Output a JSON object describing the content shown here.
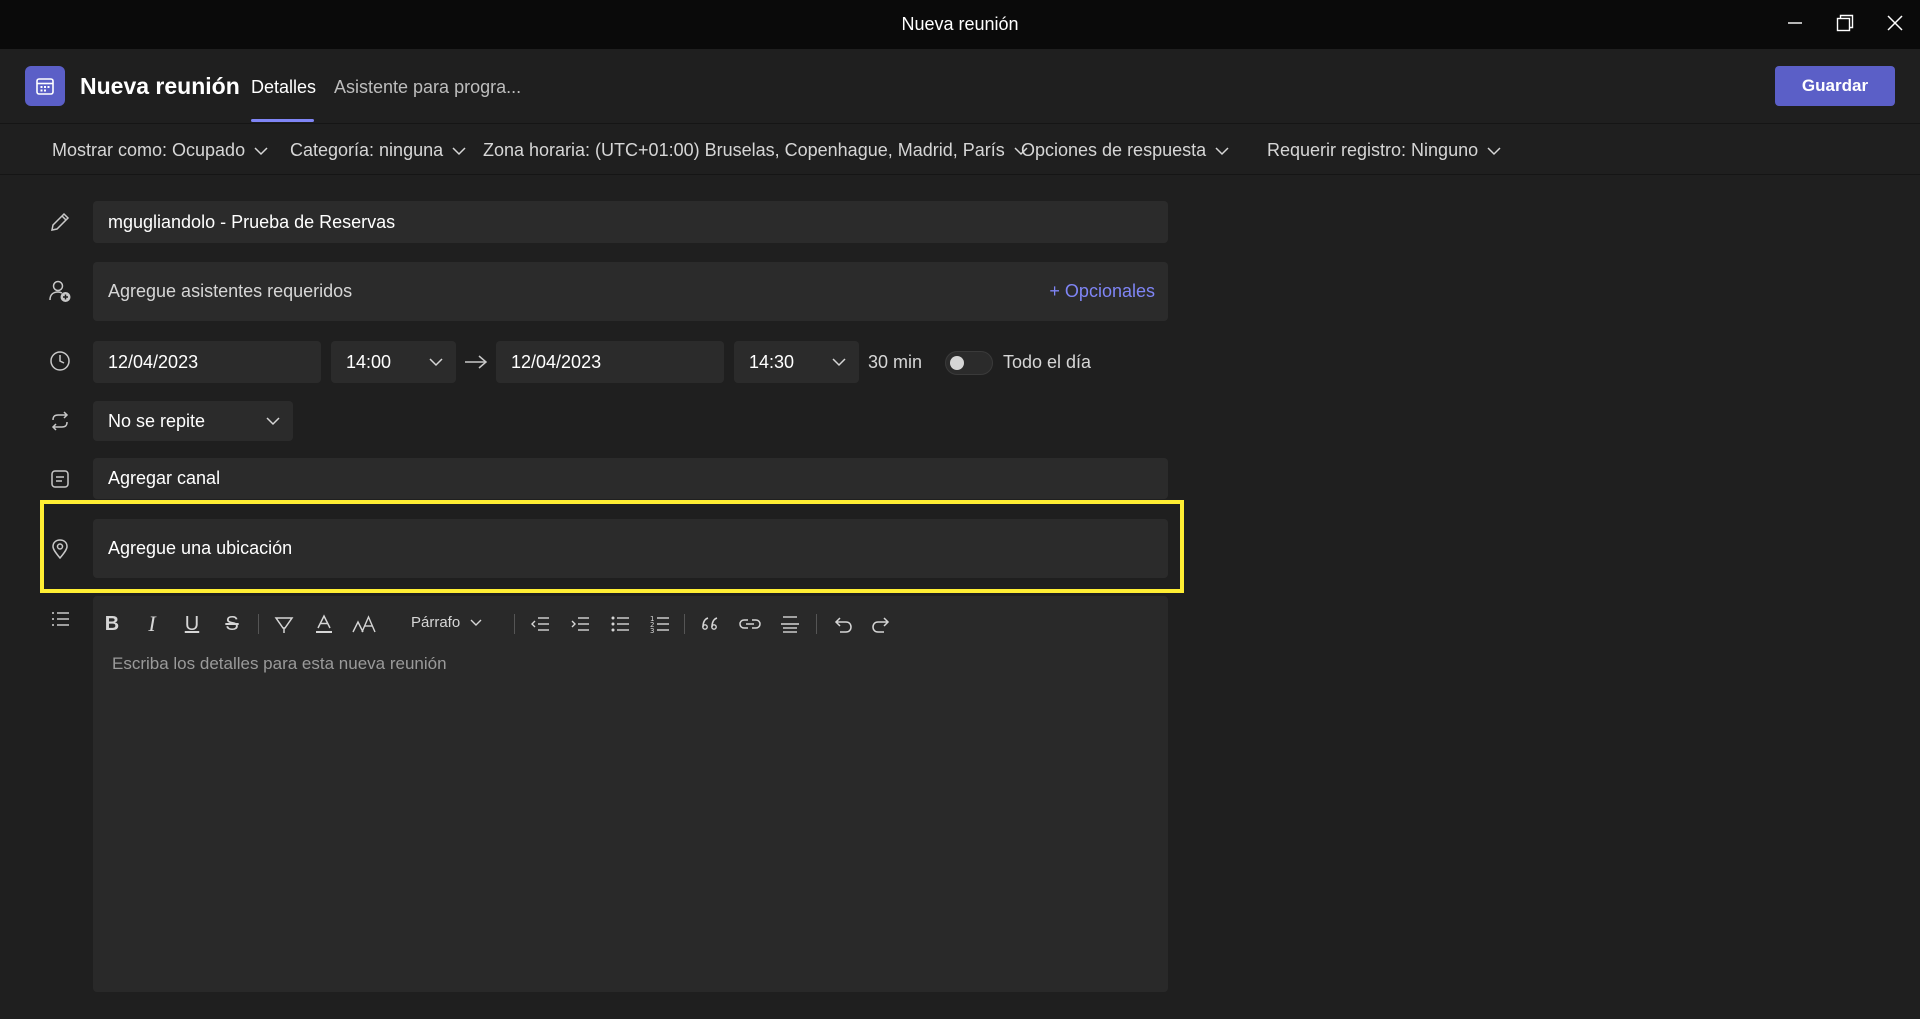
{
  "window": {
    "title": "Nueva reunión"
  },
  "header": {
    "title": "Nueva reunión",
    "tabs": [
      {
        "label": "Detalles",
        "active": true
      },
      {
        "label": "Asistente para progra..."
      }
    ],
    "save_label": "Guardar",
    "accent": "#5b5fc7"
  },
  "options": {
    "show_as": "Mostrar como: Ocupado",
    "category": "Categoría: ninguna",
    "timezone": "Zona horaria: (UTC+01:00) Bruselas, Copenhague, Madrid, París",
    "response_options": "Opciones de respuesta",
    "registration": "Requerir registro: Ninguno"
  },
  "form": {
    "title_value": "mgugliandolo - Prueba de Reservas",
    "attendees_placeholder": "Agregue asistentes requeridos",
    "optional_link": "+ Opcionales",
    "start_date": "12/04/2023",
    "start_time": "14:00",
    "end_date": "12/04/2023",
    "end_time": "14:30",
    "duration": "30 min",
    "all_day_label": "Todo el día",
    "all_day_on": false,
    "repeat": "No se repite",
    "channel_placeholder": "Agregar canal",
    "location_placeholder": "Agregue una ubicación"
  },
  "editor": {
    "paragraph_label": "Párrafo",
    "placeholder": "Escriba los detalles para esta nueva reunión"
  },
  "highlight_color": "#ffee33"
}
